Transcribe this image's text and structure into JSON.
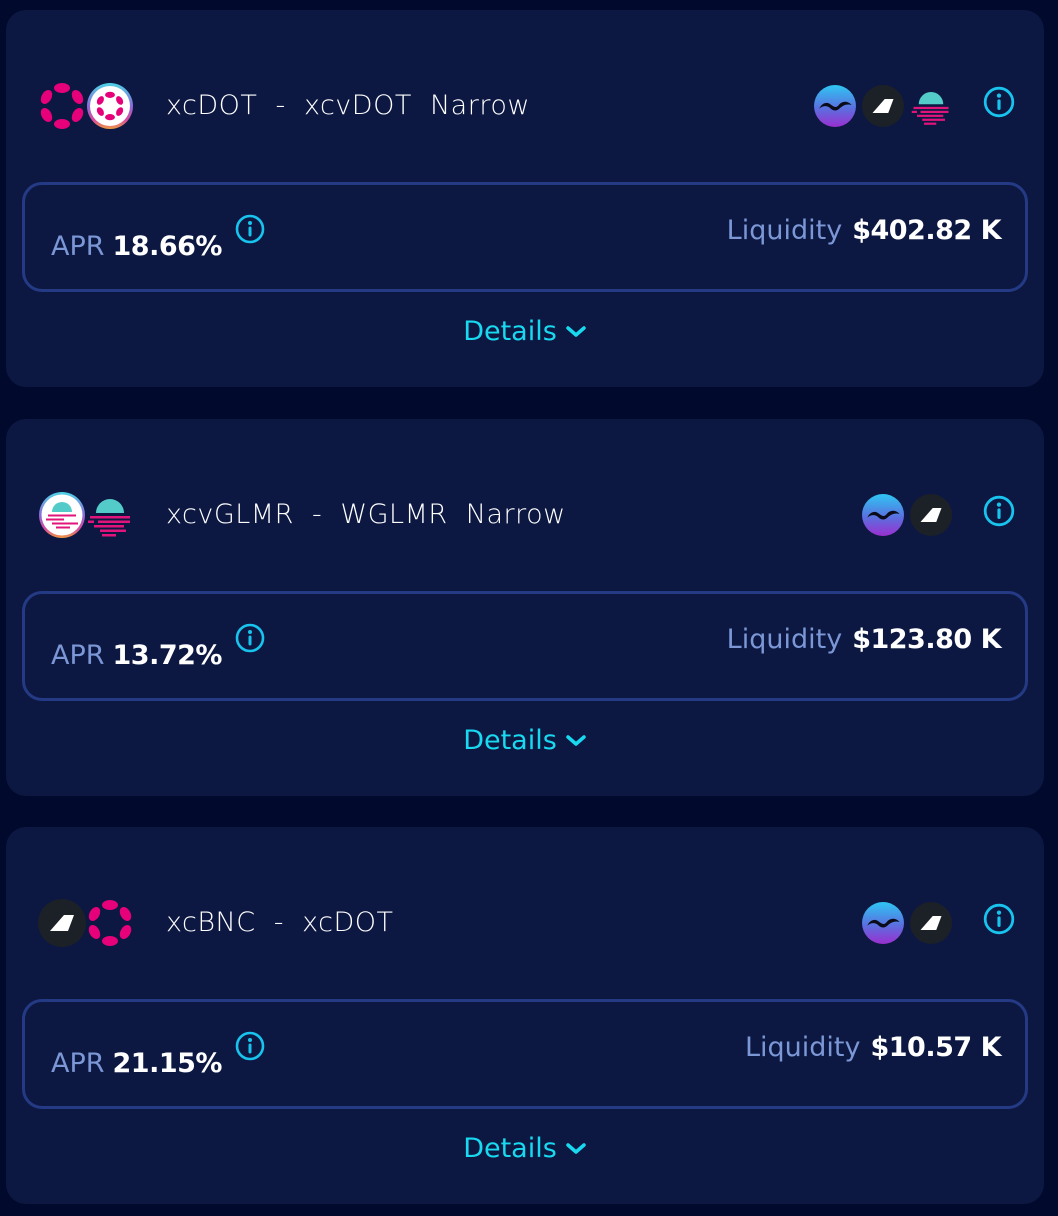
{
  "colors": {
    "page_bg": "#010a2d",
    "card_bg": "#0c1842",
    "box_border": "#243a85",
    "label": "#7b97d6",
    "value": "#ffffff",
    "accent": "#18d9f0",
    "dot_pink": "#e6007a"
  },
  "farms": [
    {
      "name": "xcDOT  -  xcvDOT  Narrow",
      "tokens": [
        "polkadot-dot-icon",
        "vdot-icon"
      ],
      "protocols": [
        "seagull-icon",
        "bifrost-icon",
        "moonbeam-icon"
      ],
      "apr_label": "APR",
      "apr_value": "18.66%",
      "liquidity_label": "Liquidity",
      "liquidity_value": "$402.82 K",
      "details_label": "Details"
    },
    {
      "name": "xcvGLMR  -  WGLMR  Narrow",
      "tokens": [
        "vglmr-icon",
        "moonbeam-glmr-icon"
      ],
      "protocols": [
        "seagull-icon",
        "bifrost-icon"
      ],
      "apr_label": "APR",
      "apr_value": "13.72%",
      "liquidity_label": "Liquidity",
      "liquidity_value": "$123.80 K",
      "details_label": "Details"
    },
    {
      "name": "xcBNC  -  xcDOT",
      "tokens": [
        "bifrost-bnc-icon",
        "polkadot-dot-icon"
      ],
      "protocols": [
        "seagull-icon",
        "bifrost-icon"
      ],
      "apr_label": "APR",
      "apr_value": "21.15%",
      "liquidity_label": "Liquidity",
      "liquidity_value": "$10.57 K",
      "details_label": "Details"
    }
  ]
}
